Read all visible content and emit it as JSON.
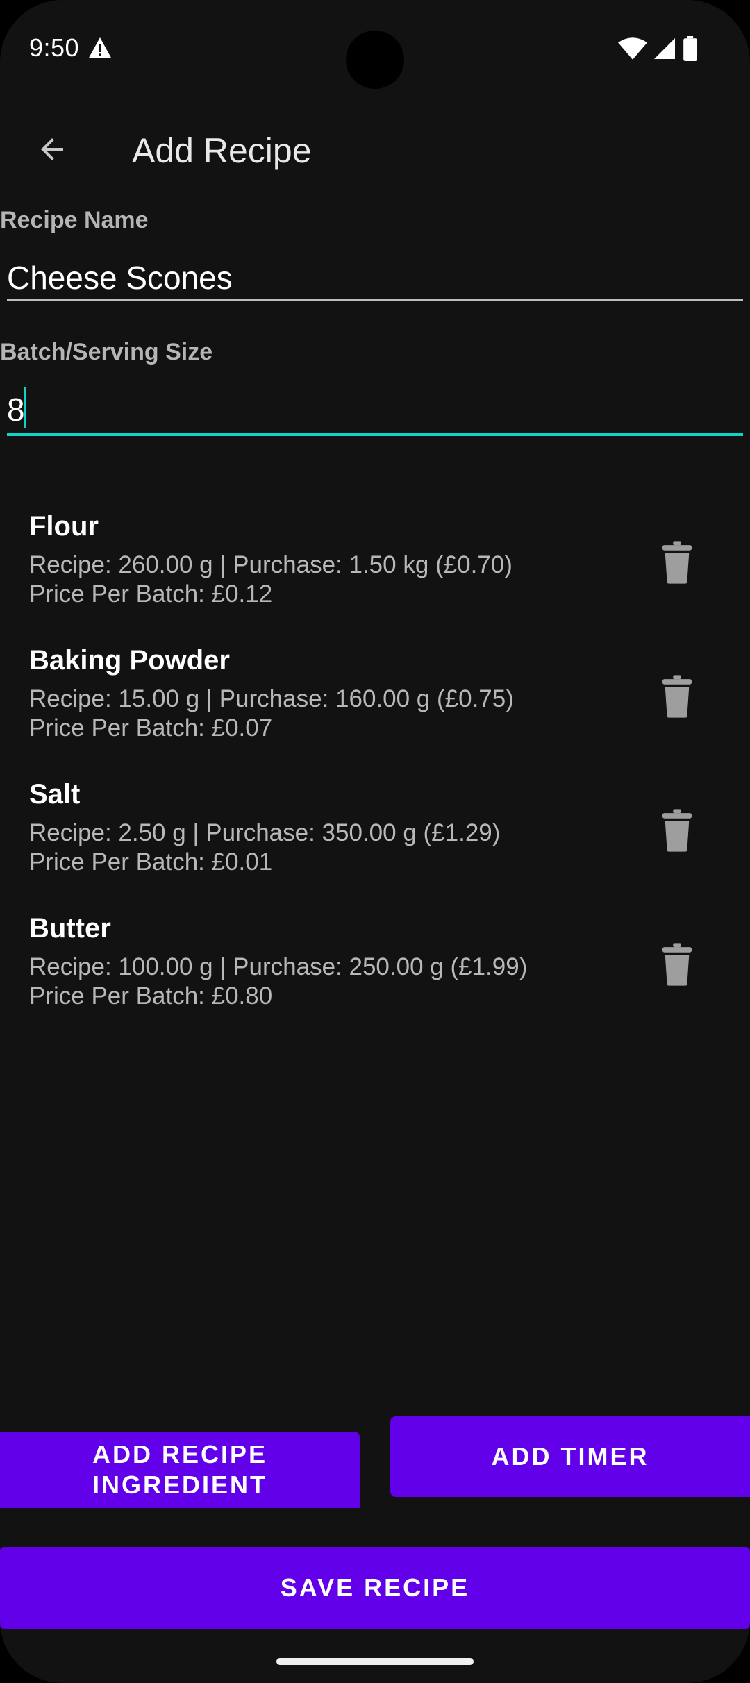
{
  "status_bar": {
    "time": "9:50",
    "icons": [
      "alert-icon",
      "wifi-icon",
      "signal-icon",
      "battery-icon"
    ]
  },
  "app_bar": {
    "back_icon": "arrow-back-icon",
    "title": "Add Recipe"
  },
  "form": {
    "recipe_name_label": "Recipe Name",
    "recipe_name_value": "Cheese Scones",
    "batch_size_label": "Batch/Serving Size",
    "batch_size_value": "8"
  },
  "ingredients": [
    {
      "name": "Flour",
      "detail": "Recipe: 260.00 g | Purchase: 1.50 kg (£0.70)",
      "price": "Price Per Batch: £0.12"
    },
    {
      "name": "Baking Powder",
      "detail": "Recipe: 15.00 g | Purchase: 160.00 g (£0.75)",
      "price": "Price Per Batch: £0.07"
    },
    {
      "name": "Salt",
      "detail": "Recipe: 2.50 g | Purchase: 350.00 g (£1.29)",
      "price": "Price Per Batch: £0.01"
    },
    {
      "name": "Butter",
      "detail": "Recipe: 100.00 g | Purchase: 250.00 g (£1.99)",
      "price": "Price Per Batch: £0.80"
    }
  ],
  "buttons": {
    "add_ingredient_line1": "ADD RECIPE",
    "add_ingredient_line2": "INGREDIENT",
    "add_timer": "ADD TIMER",
    "save_recipe": "SAVE RECIPE"
  },
  "colors": {
    "background": "#121212",
    "primary_button": "#6200ea",
    "focus_accent": "#11d3c3",
    "delete_icon": "#9e9e9e"
  }
}
